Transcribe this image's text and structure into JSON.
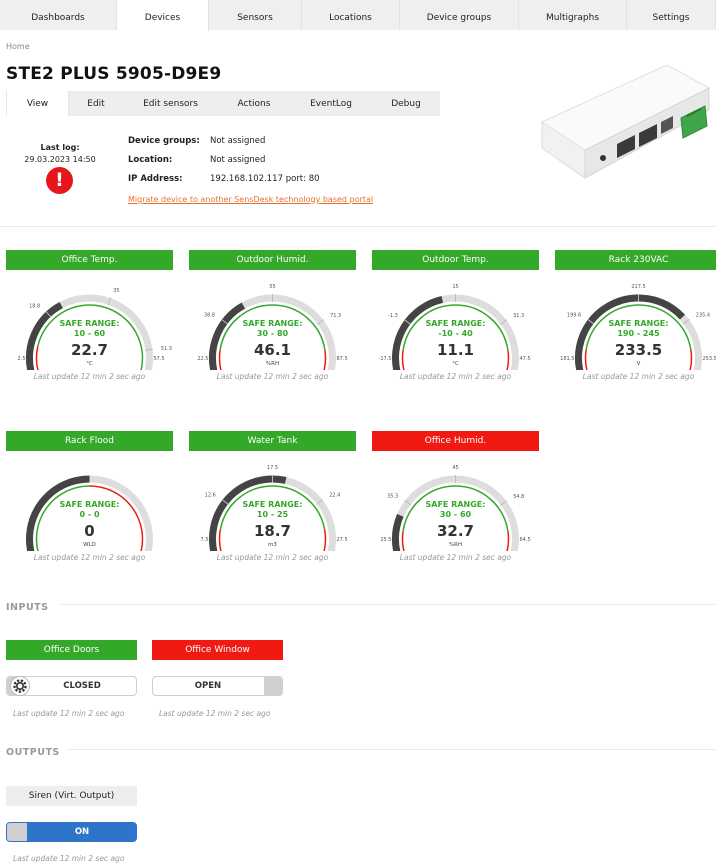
{
  "nav": {
    "tabs": [
      {
        "label": "Dashboards"
      },
      {
        "label": "Devices"
      },
      {
        "label": "Sensors"
      },
      {
        "label": "Locations"
      },
      {
        "label": "Device groups"
      },
      {
        "label": "Multigraphs"
      },
      {
        "label": "Settings"
      }
    ],
    "active": "Devices"
  },
  "breadcrumb": "Home",
  "device": {
    "title": "STE2 PLUS 5905-D9E9",
    "tabs": [
      "View",
      "Edit",
      "Edit sensors",
      "Actions",
      "EventLog",
      "Debug"
    ],
    "active_tab": "View",
    "last_log_label": "Last log:",
    "last_log_date": "29.03.2023 14:50",
    "alert_symbol": "!",
    "info": [
      {
        "key": "Device groups:",
        "value": "Not assigned"
      },
      {
        "key": "Location:",
        "value": "Not assigned"
      },
      {
        "key": "IP Address:",
        "value": "192.168.102.117 port: 80"
      }
    ],
    "migrate_link": "Migrate device to another SensDesk technology based portal"
  },
  "colors": {
    "ok": "#34a829",
    "alarm": "#f01a12",
    "needle": "#444444",
    "track": "#dddddd",
    "link": "#e8722f",
    "on": "#2e74c8"
  },
  "sensors": [
    {
      "name": "Office Temp.",
      "status": "ok",
      "value": "22.7",
      "unit": "°C",
      "range_label": "SAFE RANGE:",
      "range": "10 - 60",
      "min": 2.5,
      "max": 57.5,
      "safe_from": 10,
      "safe_to": 60,
      "ticks": [
        {
          "v": 2.5,
          "t": "2.5"
        },
        {
          "v": 18.8,
          "t": "18.8"
        },
        {
          "v": 35,
          "t": "35"
        },
        {
          "v": 51.3,
          "t": "51.3"
        },
        {
          "v": 57.5,
          "t": "57.5"
        }
      ],
      "updated": "Last update 12 min 2 sec ago"
    },
    {
      "name": "Outdoor Humid.",
      "status": "ok",
      "value": "46.1",
      "unit": "%RH",
      "range_label": "SAFE RANGE:",
      "range": "30 - 80",
      "min": 22.5,
      "max": 87.5,
      "safe_from": 30,
      "safe_to": 80,
      "ticks": [
        {
          "v": 22.5,
          "t": "22.5"
        },
        {
          "v": 38.8,
          "t": "38.8"
        },
        {
          "v": 55,
          "t": "55"
        },
        {
          "v": 71.3,
          "t": "71.3"
        },
        {
          "v": 87.5,
          "t": "87.5"
        }
      ],
      "updated": "Last update 12 min 2 sec ago"
    },
    {
      "name": "Outdoor Temp.",
      "status": "ok",
      "value": "11.1",
      "unit": "°C",
      "range_label": "SAFE RANGE:",
      "range": "-10 - 40",
      "min": -17.5,
      "max": 47.5,
      "safe_from": -10,
      "safe_to": 40,
      "ticks": [
        {
          "v": -17.5,
          "t": "-17.5"
        },
        {
          "v": -1.3,
          "t": "-1.3"
        },
        {
          "v": 15,
          "t": "15"
        },
        {
          "v": 31.3,
          "t": "31.3"
        },
        {
          "v": 47.5,
          "t": "47.5"
        }
      ],
      "updated": "Last update 12 min 2 sec ago"
    },
    {
      "name": "Rack 230VAC",
      "status": "ok",
      "value": "233.5",
      "unit": "V",
      "range_label": "SAFE RANGE:",
      "range": "190 - 245",
      "min": 181.5,
      "max": 253.5,
      "safe_from": 190,
      "safe_to": 245,
      "ticks": [
        {
          "v": 181.5,
          "t": "181.5"
        },
        {
          "v": 199.6,
          "t": "199.6"
        },
        {
          "v": 217.5,
          "t": "217.5"
        },
        {
          "v": 235.4,
          "t": "235.4"
        },
        {
          "v": 253.5,
          "t": "253.5"
        }
      ],
      "updated": "Last update 12 min 2 sec ago"
    },
    {
      "name": "Rack Flood",
      "status": "ok",
      "value": "0",
      "unit": "WLD",
      "range_label": "SAFE RANGE:",
      "range": "0 - 0",
      "min": -1,
      "max": 1,
      "safe_from": -1,
      "safe_to": 0,
      "ticks": [],
      "updated": "Last update 12 min 2 sec ago"
    },
    {
      "name": "Water Tank",
      "status": "ok",
      "value": "18.7",
      "unit": "m3",
      "range_label": "SAFE RANGE:",
      "range": "10 - 25",
      "min": 7.5,
      "max": 27.5,
      "safe_from": 10,
      "safe_to": 25,
      "ticks": [
        {
          "v": 7.5,
          "t": "7.5"
        },
        {
          "v": 12.6,
          "t": "12.6"
        },
        {
          "v": 17.5,
          "t": "17.5"
        },
        {
          "v": 22.4,
          "t": "22.4"
        },
        {
          "v": 27.5,
          "t": "27.5"
        }
      ],
      "updated": "Last update 12 min 2 sec ago"
    },
    {
      "name": "Office Humid.",
      "status": "alarm",
      "value": "32.7",
      "unit": "%RH",
      "range_label": "SAFE RANGE:",
      "range": "30 - 60",
      "min": 25.5,
      "max": 64.5,
      "safe_from": 30,
      "safe_to": 60,
      "ticks": [
        {
          "v": 25.5,
          "t": "25.5"
        },
        {
          "v": 35.3,
          "t": "35.3"
        },
        {
          "v": 45,
          "t": "45"
        },
        {
          "v": 54.8,
          "t": "54.8"
        },
        {
          "v": 64.5,
          "t": "64.5"
        }
      ],
      "updated": "Last update 12 min 2 sec ago"
    }
  ],
  "inputs": {
    "title": "INPUTS",
    "items": [
      {
        "name": "Office Doors",
        "status": "ok",
        "state": "CLOSED",
        "updated": "Last update 12 min 2 sec ago"
      },
      {
        "name": "Office Window",
        "status": "alarm",
        "state": "OPEN",
        "updated": "Last update 12 min 2 sec ago"
      }
    ]
  },
  "outputs": {
    "title": "OUTPUTS",
    "items": [
      {
        "name": "Siren (Virt. Output)",
        "state": "ON",
        "updated": "Last update 12 min 2 sec ago"
      }
    ]
  }
}
